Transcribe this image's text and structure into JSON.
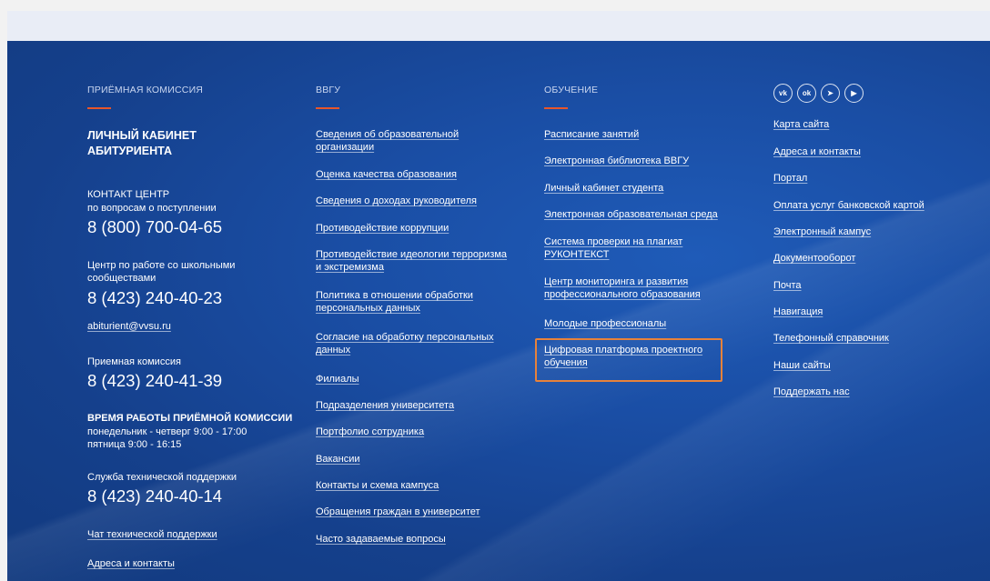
{
  "admissions": {
    "heading": "ПРИЁМНАЯ КОМИССИЯ",
    "lk_title_line1": "ЛИЧНЫЙ КАБИНЕТ",
    "lk_title_line2": "АБИТУРИЕНТА",
    "contact_center_title": "КОНТАКТ ЦЕНТР",
    "contact_center_sub": "по вопросам о поступлении",
    "contact_center_phone": "8 (800) 700-04-65",
    "school_center_line1": "Центр по работе со школьными",
    "school_center_line2": "сообществами",
    "school_center_phone": "8 (423) 240-40-23",
    "email": "abiturient@vvsu.ru",
    "commission_title": "Приемная комиссия",
    "commission_phone": "8 (423) 240-41-39",
    "hours_title": "ВРЕМЯ РАБОТЫ ПРИЁМНОЙ КОМИССИИ",
    "hours_line1": "понедельник - четверг 9:00 - 17:00",
    "hours_line2": "пятница 9:00 - 16:15",
    "support_title": "Служба технической поддержки",
    "support_phone": "8 (423) 240-40-14",
    "support_chat": "Чат технической поддержки",
    "addresses": "Адреса и контакты"
  },
  "vvgu": {
    "heading": "ВВГУ",
    "links": [
      [
        "Сведения об образовательной",
        "организации"
      ],
      [
        "Оценка качества образования"
      ],
      [
        "Сведения о доходах руководителя"
      ],
      [
        "Противодействие коррупции"
      ],
      [
        "Противодействие идеологии терроризма",
        "и экстремизма"
      ],
      [
        "Политика в отношении обработки",
        "персональных данных"
      ],
      [
        "Согласие на обработку персональных",
        "данных"
      ],
      [
        "Филиалы"
      ],
      [
        "Подразделения университета"
      ],
      [
        "Портфолио сотрудника"
      ],
      [
        "Вакансии"
      ],
      [
        "Контакты и схема кампуса"
      ],
      [
        "Обращения граждан в университет"
      ],
      [
        "Часто задаваемые вопросы"
      ]
    ]
  },
  "education": {
    "heading": "ОБУЧЕНИЕ",
    "links": [
      [
        "Расписание занятий"
      ],
      [
        "Электронная библиотека ВВГУ"
      ],
      [
        "Личный кабинет студента"
      ],
      [
        "Электронная образовательная среда"
      ],
      [
        "Система проверки на плагиат",
        "РУКОНТЕКСТ"
      ],
      [
        "Центр мониторинга и развития",
        "профессионального образования"
      ],
      [
        "Молодые профессионалы"
      ],
      [
        "Цифровая платформа проектного",
        "обучения"
      ]
    ]
  },
  "misc": {
    "social": [
      "vk-icon",
      "odnoklassniki-icon",
      "telegram-icon",
      "youtube-icon"
    ],
    "links": [
      "Карта сайта",
      "Адреса и контакты",
      "Портал",
      "Оплата услуг банковской картой",
      "Электронный кампус",
      "Документооборот",
      "Почта",
      "Навигация",
      "Телефонный справочник",
      "Наши сайты",
      "Поддержать нас"
    ]
  },
  "colors": {
    "accent": "#e8562a",
    "highlight": "#e8823a",
    "background": "#1a4ea5"
  }
}
